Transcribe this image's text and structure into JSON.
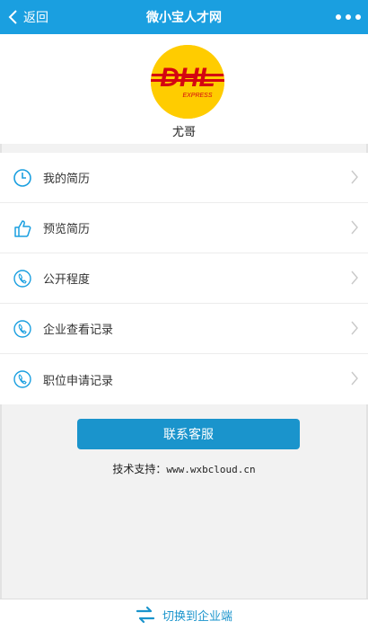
{
  "header": {
    "back_label": "返回",
    "title": "微小宝人才网"
  },
  "profile": {
    "logo_text": "DHL",
    "logo_subtext": "EXPRESS",
    "username": "尤哥"
  },
  "menu": {
    "items": [
      {
        "label": "我的简历",
        "icon": "clock-icon"
      },
      {
        "label": "预览简历",
        "icon": "thumbs-up-icon"
      },
      {
        "label": "公开程度",
        "icon": "phone-icon"
      },
      {
        "label": "企业查看记录",
        "icon": "phone-icon"
      },
      {
        "label": "职位申请记录",
        "icon": "phone-icon"
      }
    ]
  },
  "contact_button": "联系客服",
  "support": {
    "label": "技术支持：",
    "url": "www.wxbcloud.cn"
  },
  "bottom": {
    "switch_label": "切换到企业端"
  },
  "colors": {
    "accent": "#1a9fe0",
    "button": "#1a94cc",
    "logo_yellow": "#ffcc00",
    "logo_red": "#d40511"
  }
}
